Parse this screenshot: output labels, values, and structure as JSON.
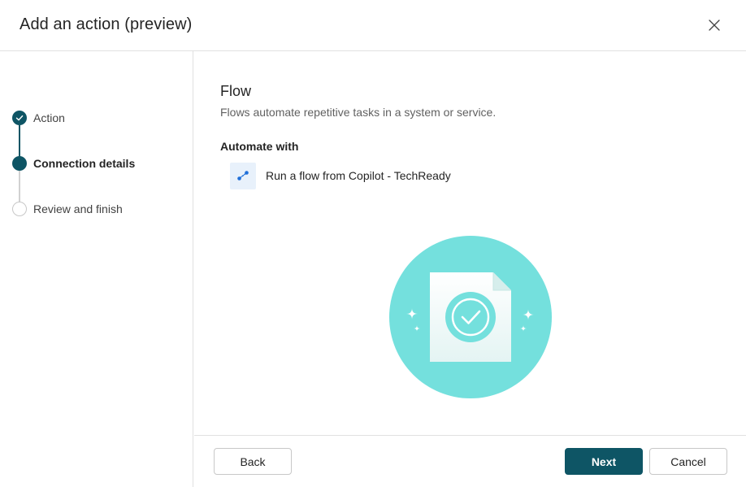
{
  "dialog": {
    "title": "Add an action (preview)"
  },
  "steps": [
    {
      "label": "Action",
      "state": "done"
    },
    {
      "label": "Connection details",
      "state": "current"
    },
    {
      "label": "Review and finish",
      "state": "pending"
    }
  ],
  "main": {
    "title": "Flow",
    "description": "Flows automate repetitive tasks in a system or service.",
    "automate_label": "Automate with",
    "flow_name": "Run a flow from Copilot - TechReady"
  },
  "footer": {
    "back_label": "Back",
    "next_label": "Next",
    "cancel_label": "Cancel"
  },
  "colors": {
    "accent": "#0e5565",
    "illustration_circle": "#74e0dd",
    "flow_icon": "#1e6fd9"
  },
  "icons": {
    "close": "close-icon",
    "checkmark": "checkmark-icon",
    "flow": "flow-icon",
    "illustration": "document-check-illustration"
  }
}
